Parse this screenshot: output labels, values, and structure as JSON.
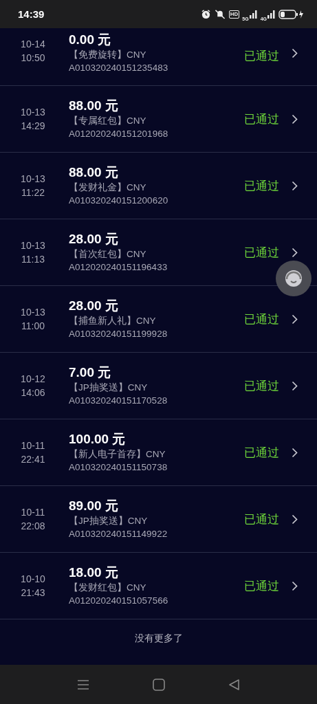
{
  "status_bar": {
    "time": "14:39",
    "hd": "HD",
    "net1": "5G",
    "net2": "4G"
  },
  "records": [
    {
      "date": "10-14",
      "time": "10:50",
      "amount": "0.00 元",
      "type": "【免费旋转】CNY",
      "order_no": "A010320240151235483",
      "status": "已通过"
    },
    {
      "date": "10-13",
      "time": "14:29",
      "amount": "88.00 元",
      "type": "【专属红包】CNY",
      "order_no": "A012020240151201968",
      "status": "已通过"
    },
    {
      "date": "10-13",
      "time": "11:22",
      "amount": "88.00 元",
      "type": "【发财礼金】CNY",
      "order_no": "A010320240151200620",
      "status": "已通过"
    },
    {
      "date": "10-13",
      "time": "11:13",
      "amount": "28.00 元",
      "type": "【首次红包】CNY",
      "order_no": "A012020240151196433",
      "status": "已通过"
    },
    {
      "date": "10-13",
      "time": "11:00",
      "amount": "28.00 元",
      "type": "【捕鱼新人礼】CNY",
      "order_no": "A010320240151199928",
      "status": "已通过"
    },
    {
      "date": "10-12",
      "time": "14:06",
      "amount": "7.00 元",
      "type": "【JP抽奖送】CNY",
      "order_no": "A010320240151170528",
      "status": "已通过"
    },
    {
      "date": "10-11",
      "time": "22:41",
      "amount": "100.00 元",
      "type": "【新人电子首存】CNY",
      "order_no": "A010320240151150738",
      "status": "已通过"
    },
    {
      "date": "10-11",
      "time": "22:08",
      "amount": "89.00 元",
      "type": "【JP抽奖送】CNY",
      "order_no": "A010320240151149922",
      "status": "已通过"
    },
    {
      "date": "10-10",
      "time": "21:43",
      "amount": "18.00 元",
      "type": "【发财红包】CNY",
      "order_no": "A012020240151057566",
      "status": "已通过"
    }
  ],
  "footer": "没有更多了"
}
